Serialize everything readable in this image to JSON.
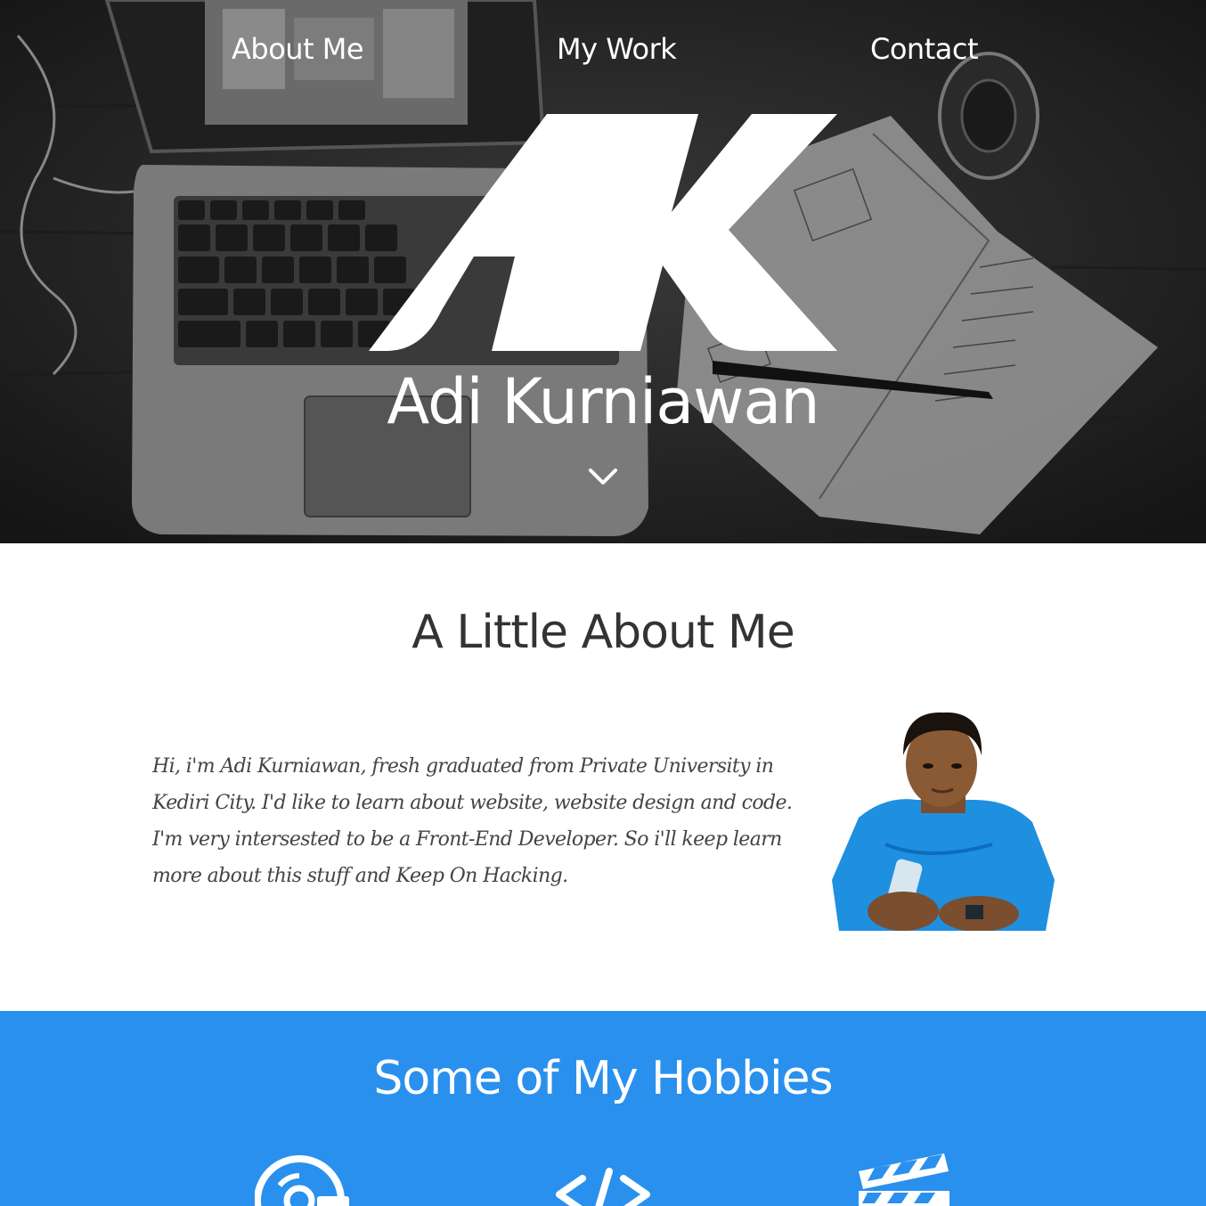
{
  "nav": {
    "items": [
      "About Me",
      "My Work",
      "Contact"
    ]
  },
  "hero": {
    "logo_text": "AK",
    "name": "Adi Kurniawan",
    "scroll_icon": "chevron-down-icon"
  },
  "about": {
    "title": "A Little About Me",
    "paragraph": "Hi, i'm Adi Kurniawan, fresh graduated from Private University in Kediri City. I'd like to learn about website, website design and code. I'm very intersested to be a Front-End Developer. So i'll keep learn more about this stuff and Keep On Hacking."
  },
  "hobbies": {
    "title": "Some of My Hobbies",
    "icons": [
      "music-disc-icon",
      "code-icon",
      "film-clapper-icon"
    ]
  },
  "colors": {
    "hero_overlay": "#2a2a2a",
    "hobbies_bg": "#2a90ee",
    "text_dark": "#333333"
  }
}
